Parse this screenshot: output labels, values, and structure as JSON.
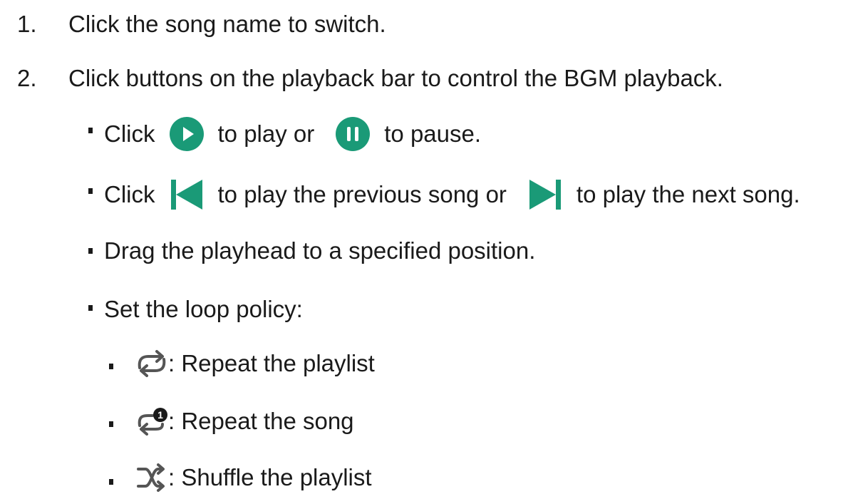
{
  "steps": [
    {
      "number": "1.",
      "text": "Click the song name to switch."
    },
    {
      "number": "2.",
      "text": "Click buttons on the playback bar to control the BGM playback."
    }
  ],
  "playback": {
    "click": "Click",
    "play_pause_play_text": "to play or",
    "play_pause_pause_text": "to pause.",
    "prev_text": "to play the previous song or",
    "next_text": "to play the next song.",
    "drag_text": "Drag the playhead to a specified position.",
    "loop_heading": "Set the loop policy:"
  },
  "loop_policies": [
    {
      "icon": "repeat-icon",
      "label": ": Repeat the playlist"
    },
    {
      "icon": "repeat-one-icon",
      "label": ": Repeat the song",
      "badge": "1"
    },
    {
      "icon": "shuffle-icon",
      "label": ": Shuffle the playlist"
    }
  ],
  "colors": {
    "accent": "#1a9a77",
    "text": "#1a1a1a",
    "icon_gray": "#555555"
  }
}
